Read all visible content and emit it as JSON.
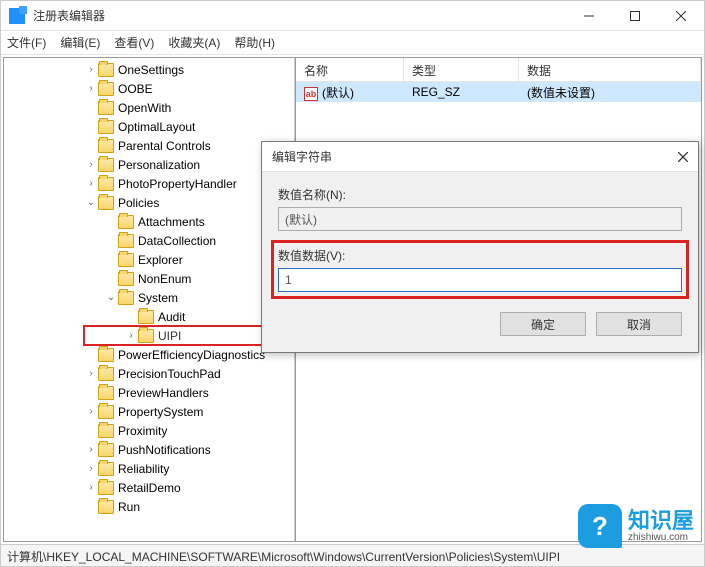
{
  "window": {
    "title": "注册表编辑器"
  },
  "menu": {
    "file": "文件(F)",
    "edit": "编辑(E)",
    "view": "查看(V)",
    "fav": "收藏夹(A)",
    "help": "帮助(H)"
  },
  "tree": {
    "items": [
      {
        "label": "OneSettings",
        "exp": "›",
        "ind": 0
      },
      {
        "label": "OOBE",
        "exp": "›",
        "ind": 0
      },
      {
        "label": "OpenWith",
        "exp": "",
        "ind": 0
      },
      {
        "label": "OptimalLayout",
        "exp": "",
        "ind": 0
      },
      {
        "label": "Parental Controls",
        "exp": "",
        "ind": 0
      },
      {
        "label": "Personalization",
        "exp": "›",
        "ind": 0
      },
      {
        "label": "PhotoPropertyHandler",
        "exp": "›",
        "ind": 0
      },
      {
        "label": "Policies",
        "exp": "⌄",
        "ind": 0
      },
      {
        "label": "Attachments",
        "exp": "",
        "ind": 1
      },
      {
        "label": "DataCollection",
        "exp": "",
        "ind": 1
      },
      {
        "label": "Explorer",
        "exp": "",
        "ind": 1
      },
      {
        "label": "NonEnum",
        "exp": "",
        "ind": 1
      },
      {
        "label": "System",
        "exp": "⌄",
        "ind": 1
      },
      {
        "label": "Audit",
        "exp": "",
        "ind": 2
      },
      {
        "label": "UIPI",
        "exp": "›",
        "ind": 2,
        "highlight": true
      },
      {
        "label": "PowerEfficiencyDiagnostics",
        "exp": "",
        "ind": 0
      },
      {
        "label": "PrecisionTouchPad",
        "exp": "›",
        "ind": 0
      },
      {
        "label": "PreviewHandlers",
        "exp": "",
        "ind": 0
      },
      {
        "label": "PropertySystem",
        "exp": "›",
        "ind": 0
      },
      {
        "label": "Proximity",
        "exp": "",
        "ind": 0
      },
      {
        "label": "PushNotifications",
        "exp": "›",
        "ind": 0
      },
      {
        "label": "Reliability",
        "exp": "›",
        "ind": 0
      },
      {
        "label": "RetailDemo",
        "exp": "›",
        "ind": 0
      },
      {
        "label": "Run",
        "exp": "",
        "ind": 0
      }
    ]
  },
  "list": {
    "headers": {
      "name": "名称",
      "type": "类型",
      "data": "数据"
    },
    "row": {
      "icon": "ab",
      "name": "(默认)",
      "type": "REG_SZ",
      "data": "(数值未设置)"
    }
  },
  "dialog": {
    "title": "编辑字符串",
    "name_label": "数值名称(N):",
    "name_value": "(默认)",
    "data_label": "数值数据(V):",
    "data_value": "1",
    "ok": "确定",
    "cancel": "取消"
  },
  "statusbar": "计算机\\HKEY_LOCAL_MACHINE\\SOFTWARE\\Microsoft\\Windows\\CurrentVersion\\Policies\\System\\UIPI",
  "watermark": {
    "zh": "知识屋",
    "en": "zhishiwu.com",
    "q": "?"
  }
}
